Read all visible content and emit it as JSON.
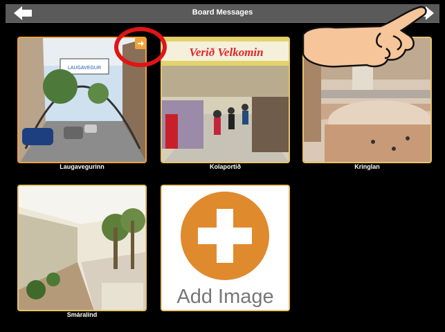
{
  "header": {
    "title": "Board Messages"
  },
  "navigation": {
    "back_icon": "arrow-left-icon",
    "forward_icon": "arrow-right-icon"
  },
  "tiles": [
    {
      "label": "Laugavegurinn",
      "selected": true
    },
    {
      "label": "Kolaportið",
      "sign_text": "Verið Velkomin"
    },
    {
      "label": "Kringlan"
    },
    {
      "label": "Smáralind"
    }
  ],
  "add_image": {
    "label": "Add Image",
    "icon": "plus-icon"
  },
  "annotations": {
    "badge_icon": "arrow-right-icon",
    "highlight_color": "#e01515",
    "pointer_icon": "pointing-hand-icon"
  },
  "colors": {
    "accent": "#f0a23a",
    "add_circle": "#e08a2e"
  }
}
